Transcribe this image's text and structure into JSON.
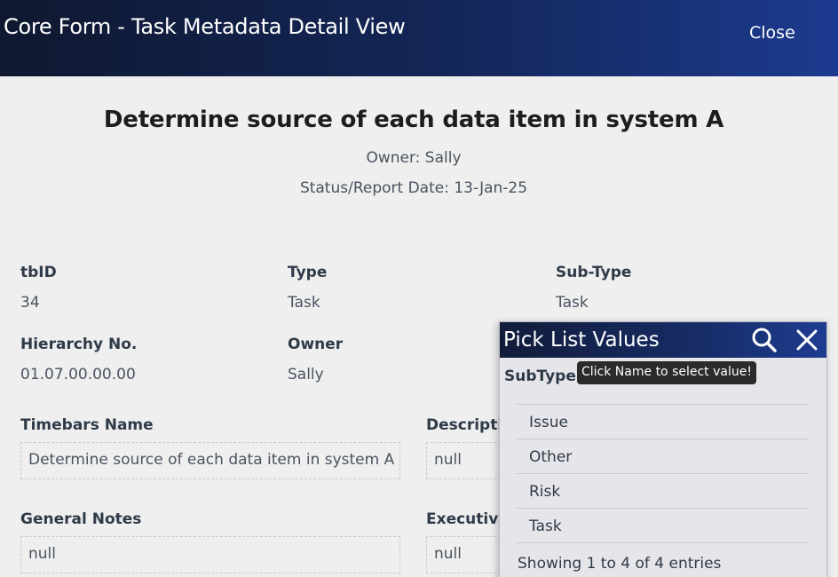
{
  "header": {
    "title": "Core Form - Task Metadata Detail View",
    "close_label": "Close"
  },
  "task": {
    "title": "Determine source of each data item in system A",
    "owner_line": "Owner: Sally",
    "status_line": "Status/Report Date: 13-Jan-25"
  },
  "fields": {
    "tbid": {
      "label": "tbID",
      "value": "34"
    },
    "type": {
      "label": "Type",
      "value": "Task"
    },
    "subtype": {
      "label": "Sub-Type",
      "value": "Task"
    },
    "hierarchy": {
      "label": "Hierarchy No.",
      "value": "01.07.00.00.00"
    },
    "owner": {
      "label": "Owner",
      "value": "Sally"
    },
    "timebars_name": {
      "label": "Timebars Name",
      "value": "Determine source of each data item in system A"
    },
    "description": {
      "label": "Descriptio",
      "value": "null"
    },
    "general_notes": {
      "label": "General Notes",
      "value": "null"
    },
    "executive": {
      "label": "Executive",
      "value": "null"
    }
  },
  "picklist": {
    "title": "Pick List Values",
    "field_name": "SubType",
    "tooltip": "Click Name to select value!",
    "items": [
      "Issue",
      "Other",
      "Risk",
      "Task"
    ],
    "footer": "Showing 1 to 4 of 4 entries",
    "icons": {
      "search": "search-icon",
      "close": "close-icon"
    }
  },
  "colors": {
    "header_start": "#0f1830",
    "header_end": "#1c3a8f",
    "background": "#efefef",
    "tooltip_bg": "#2b2b2b"
  }
}
